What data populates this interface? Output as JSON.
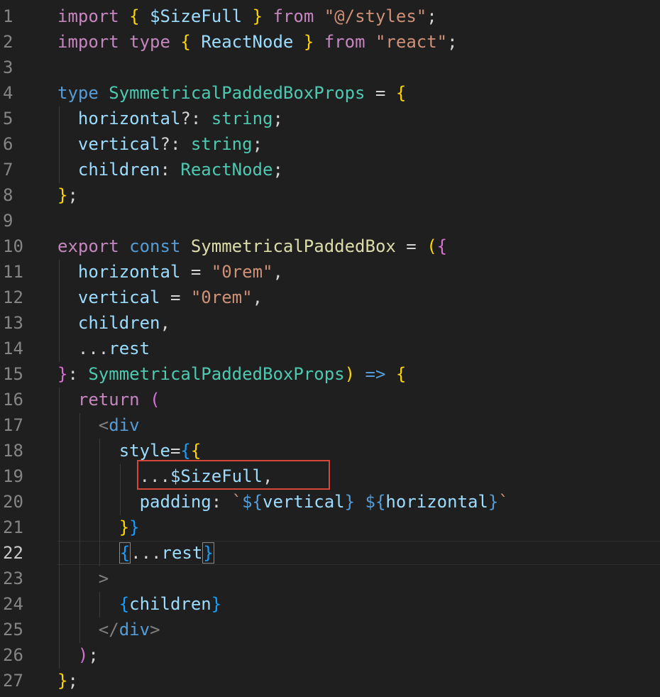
{
  "editor": {
    "active_line": 22,
    "highlight_note": "red annotation box around line 19",
    "lines": [
      {
        "n": "1",
        "tokens": [
          [
            "kw",
            "import"
          ],
          [
            "pun",
            " "
          ],
          [
            "br1",
            "{"
          ],
          [
            "pun",
            " "
          ],
          [
            "var",
            "$SizeFull"
          ],
          [
            "pun",
            " "
          ],
          [
            "br1",
            "}"
          ],
          [
            "pun",
            " "
          ],
          [
            "kw",
            "from"
          ],
          [
            "pun",
            " "
          ],
          [
            "str",
            "\"@/styles\""
          ],
          [
            "pun",
            ";"
          ]
        ]
      },
      {
        "n": "2",
        "tokens": [
          [
            "kw",
            "import"
          ],
          [
            "pun",
            " "
          ],
          [
            "kw",
            "type"
          ],
          [
            "pun",
            " "
          ],
          [
            "br1",
            "{"
          ],
          [
            "pun",
            " "
          ],
          [
            "var",
            "ReactNode"
          ],
          [
            "pun",
            " "
          ],
          [
            "br1",
            "}"
          ],
          [
            "pun",
            " "
          ],
          [
            "kw",
            "from"
          ],
          [
            "pun",
            " "
          ],
          [
            "str",
            "\"react\""
          ],
          [
            "pun",
            ";"
          ]
        ]
      },
      {
        "n": "3",
        "tokens": []
      },
      {
        "n": "4",
        "tokens": [
          [
            "kwb",
            "type"
          ],
          [
            "pun",
            " "
          ],
          [
            "type",
            "SymmetricalPaddedBoxProps"
          ],
          [
            "pun",
            " = "
          ],
          [
            "br1",
            "{"
          ]
        ]
      },
      {
        "n": "5",
        "tokens": [
          [
            "pun",
            "  "
          ],
          [
            "var",
            "horizontal"
          ],
          [
            "pun",
            "?: "
          ],
          [
            "type",
            "string"
          ],
          [
            "pun",
            ";"
          ]
        ]
      },
      {
        "n": "6",
        "tokens": [
          [
            "pun",
            "  "
          ],
          [
            "var",
            "vertical"
          ],
          [
            "pun",
            "?: "
          ],
          [
            "type",
            "string"
          ],
          [
            "pun",
            ";"
          ]
        ]
      },
      {
        "n": "7",
        "tokens": [
          [
            "pun",
            "  "
          ],
          [
            "var",
            "children"
          ],
          [
            "pun",
            ": "
          ],
          [
            "type",
            "ReactNode"
          ],
          [
            "pun",
            ";"
          ]
        ]
      },
      {
        "n": "8",
        "tokens": [
          [
            "br1",
            "}"
          ],
          [
            "pun",
            ";"
          ]
        ]
      },
      {
        "n": "9",
        "tokens": []
      },
      {
        "n": "10",
        "tokens": [
          [
            "kw",
            "export"
          ],
          [
            "pun",
            " "
          ],
          [
            "kwb",
            "const"
          ],
          [
            "pun",
            " "
          ],
          [
            "fn",
            "SymmetricalPaddedBox"
          ],
          [
            "pun",
            " = "
          ],
          [
            "br1",
            "("
          ],
          [
            "br2",
            "{"
          ]
        ]
      },
      {
        "n": "11",
        "tokens": [
          [
            "pun",
            "  "
          ],
          [
            "var",
            "horizontal"
          ],
          [
            "pun",
            " = "
          ],
          [
            "str",
            "\"0rem\""
          ],
          [
            "pun",
            ","
          ]
        ]
      },
      {
        "n": "12",
        "tokens": [
          [
            "pun",
            "  "
          ],
          [
            "var",
            "vertical"
          ],
          [
            "pun",
            " = "
          ],
          [
            "str",
            "\"0rem\""
          ],
          [
            "pun",
            ","
          ]
        ]
      },
      {
        "n": "13",
        "tokens": [
          [
            "pun",
            "  "
          ],
          [
            "var",
            "children"
          ],
          [
            "pun",
            ","
          ]
        ]
      },
      {
        "n": "14",
        "tokens": [
          [
            "pun",
            "  ..."
          ],
          [
            "var",
            "rest"
          ]
        ]
      },
      {
        "n": "15",
        "tokens": [
          [
            "br2",
            "}"
          ],
          [
            "pun",
            ": "
          ],
          [
            "type",
            "SymmetricalPaddedBoxProps"
          ],
          [
            "br1",
            ")"
          ],
          [
            "pun",
            " "
          ],
          [
            "kwb",
            "=>"
          ],
          [
            "pun",
            " "
          ],
          [
            "br1",
            "{"
          ]
        ]
      },
      {
        "n": "16",
        "tokens": [
          [
            "pun",
            "  "
          ],
          [
            "kw",
            "return"
          ],
          [
            "pun",
            " "
          ],
          [
            "br2",
            "("
          ]
        ]
      },
      {
        "n": "17",
        "tokens": [
          [
            "pun",
            "    "
          ],
          [
            "tagp",
            "<"
          ],
          [
            "tag",
            "div"
          ]
        ]
      },
      {
        "n": "18",
        "tokens": [
          [
            "pun",
            "      "
          ],
          [
            "var",
            "style"
          ],
          [
            "pun",
            "="
          ],
          [
            "br3",
            "{"
          ],
          [
            "br1",
            "{"
          ]
        ]
      },
      {
        "n": "19",
        "tokens": [
          [
            "pun",
            "        ..."
          ],
          [
            "var",
            "$SizeFull"
          ],
          [
            "pun",
            ","
          ]
        ]
      },
      {
        "n": "20",
        "tokens": [
          [
            "pun",
            "        "
          ],
          [
            "var",
            "padding"
          ],
          [
            "pun",
            ": "
          ],
          [
            "str",
            "`"
          ],
          [
            "tmpl",
            "${"
          ],
          [
            "var",
            "vertical"
          ],
          [
            "tmpl",
            "}"
          ],
          [
            "str",
            " "
          ],
          [
            "tmpl",
            "${"
          ],
          [
            "var",
            "horizontal"
          ],
          [
            "tmpl",
            "}"
          ],
          [
            "str",
            "`"
          ]
        ]
      },
      {
        "n": "21",
        "tokens": [
          [
            "pun",
            "      "
          ],
          [
            "br1",
            "}"
          ],
          [
            "br3",
            "}"
          ]
        ]
      },
      {
        "n": "22",
        "tokens": [
          [
            "pun",
            "      "
          ],
          [
            "br3",
            "{"
          ],
          [
            "pun",
            "..."
          ],
          [
            "var",
            "rest"
          ],
          [
            "br3",
            "}"
          ]
        ]
      },
      {
        "n": "23",
        "tokens": [
          [
            "pun",
            "    "
          ],
          [
            "tagp",
            ">"
          ]
        ]
      },
      {
        "n": "24",
        "tokens": [
          [
            "pun",
            "      "
          ],
          [
            "br3",
            "{"
          ],
          [
            "var",
            "children"
          ],
          [
            "br3",
            "}"
          ]
        ]
      },
      {
        "n": "25",
        "tokens": [
          [
            "pun",
            "    "
          ],
          [
            "tagp",
            "</"
          ],
          [
            "tag",
            "div"
          ],
          [
            "tagp",
            ">"
          ]
        ]
      },
      {
        "n": "26",
        "tokens": [
          [
            "pun",
            "  "
          ],
          [
            "br2",
            ")"
          ],
          [
            "pun",
            ";"
          ]
        ]
      },
      {
        "n": "27",
        "tokens": [
          [
            "br1",
            "}"
          ],
          [
            "pun",
            ";"
          ]
        ]
      }
    ]
  }
}
